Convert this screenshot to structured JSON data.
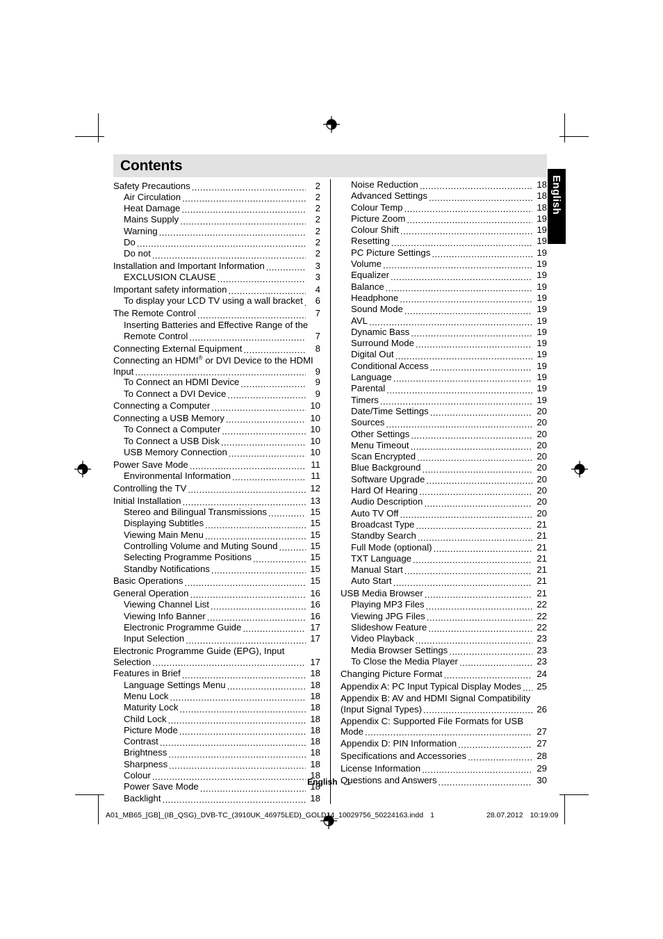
{
  "document": {
    "header_title": "Contents",
    "language_tab": "English",
    "footer": {
      "language": "English",
      "page_number": "- 1 -"
    },
    "print_info": {
      "filename": "A01_MB65_[GB]_(IB_QSG)_DVB-TC_(3910UK_46975LED)_GOLD14_10029756_50224163.indd",
      "sheet": "1",
      "date": "28.07.2012",
      "time": "10:19:09"
    }
  },
  "toc": {
    "left_column": [
      {
        "title": "Safety Precautions",
        "page": "2",
        "level": 1
      },
      {
        "title": "Air Circulation",
        "page": "2",
        "level": 2
      },
      {
        "title": "Heat Damage",
        "page": "2",
        "level": 2
      },
      {
        "title": "Mains Supply",
        "page": "2",
        "level": 2
      },
      {
        "title": "Warning ",
        "page": "2",
        "level": 2
      },
      {
        "title": "Do",
        "page": "2",
        "level": 2
      },
      {
        "title": "Do not",
        "page": "2",
        "level": 2
      },
      {
        "title": "Installation and Important Information",
        "page": "3",
        "level": 1
      },
      {
        "title": "EXCLUSION CLAUSE",
        "page": "3",
        "level": 2
      },
      {
        "title": "Important safety information ",
        "page": "4",
        "level": 1
      },
      {
        "title": "To display your LCD TV using a wall bracket",
        "page": "6",
        "level": 2
      },
      {
        "title": "The Remote Control",
        "page": "7",
        "level": 1
      },
      {
        "title": "Inserting Batteries and Effective Range of the",
        "title2": "Remote Control",
        "page": "7",
        "level": 2,
        "wrap": true
      },
      {
        "title": "Connecting External Equipment",
        "page": "8",
        "level": 1
      },
      {
        "title": "Connecting an HDMI",
        "sup": "®",
        "title_after_sup": " or DVI Device to the HDMI",
        "title2": "Input",
        "page": "9",
        "level": 1,
        "wrap": true,
        "tight": true
      },
      {
        "title": "To Connect an HDMI Device",
        "page": "9",
        "level": 2
      },
      {
        "title": "To Connect a DVI Device",
        "page": "9",
        "level": 2
      },
      {
        "title": "Connecting a Computer",
        "page": "10",
        "level": 1
      },
      {
        "title": "Connecting a USB Memory",
        "page": "10",
        "level": 1
      },
      {
        "title": "To Connect a Computer",
        "page": "10",
        "level": 2
      },
      {
        "title": "To Connect a USB Disk",
        "page": "10",
        "level": 2
      },
      {
        "title": "USB Memory Connection",
        "page": "10",
        "level": 2
      },
      {
        "title": "Power Save Mode",
        "page": "11",
        "level": 1
      },
      {
        "title": "Environmental Information ",
        "page": "11",
        "level": 2
      },
      {
        "title": "Controlling the TV",
        "page": "12",
        "level": 1
      },
      {
        "title": "Initial Installation ",
        "page": "13",
        "level": 1
      },
      {
        "title": "Stereo and Bilingual Transmissions",
        "page": "15",
        "level": 2
      },
      {
        "title": "Displaying Subtitles",
        "page": "15",
        "level": 2
      },
      {
        "title": "Viewing Main Menu",
        "page": "15",
        "level": 2
      },
      {
        "title": "Controlling Volume and Muting Sound",
        "page": "15",
        "level": 2
      },
      {
        "title": "Selecting Programme Positions",
        "page": "15",
        "level": 2
      },
      {
        "title": "Standby Notifications",
        "page": "15",
        "level": 2
      },
      {
        "title": "Basic Operations",
        "page": "15",
        "level": 1
      },
      {
        "title": "General Operation",
        "page": "16",
        "level": 1
      },
      {
        "title": "Viewing Channel List",
        "page": "16",
        "level": 2
      },
      {
        "title": "Viewing Info Banner",
        "page": "16",
        "level": 2
      },
      {
        "title": "Electronic Programme Guide",
        "page": "17",
        "level": 2
      },
      {
        "title": "Input Selection",
        "page": "17",
        "level": 2
      },
      {
        "title": "Electronic Programme Guide (EPG), Input",
        "title2": "Selection",
        "page": "17",
        "level": 1,
        "wrap": true,
        "tight": true
      },
      {
        "title": "Features in Brief ",
        "page": "18",
        "level": 1
      },
      {
        "title": "Language Settings Menu",
        "page": "18",
        "level": 2
      },
      {
        "title": "Menu Lock",
        "page": "18",
        "level": 2
      },
      {
        "title": "Maturity Lock",
        "page": "18",
        "level": 2
      },
      {
        "title": "Child Lock",
        "page": "18",
        "level": 2
      },
      {
        "title": "Picture Mode",
        "page": "18",
        "level": 2
      },
      {
        "title": "Contrast",
        "page": "18",
        "level": 2
      },
      {
        "title": "Brightness",
        "page": "18",
        "level": 2
      },
      {
        "title": "Sharpness",
        "page": "18",
        "level": 2
      },
      {
        "title": "Colour",
        "page": "18",
        "level": 2
      },
      {
        "title": "Power Save Mode ",
        "page": "18",
        "level": 2
      },
      {
        "title": "Backlight",
        "page": "18",
        "level": 2
      }
    ],
    "right_column": [
      {
        "title": "Noise Reduction",
        "page": "18",
        "level": 2
      },
      {
        "title": "Advanced Settings",
        "page": "18",
        "level": 2
      },
      {
        "title": "Colour Temp",
        "page": "18",
        "level": 2
      },
      {
        "title": "Picture Zoom",
        "page": "19",
        "level": 2
      },
      {
        "title": "Colour Shift",
        "page": "19",
        "level": 2
      },
      {
        "title": "Resetting",
        "page": "19",
        "level": 2
      },
      {
        "title": "PC Picture Settings",
        "page": "19",
        "level": 2
      },
      {
        "title": "Volume",
        "page": "19",
        "level": 2
      },
      {
        "title": "Equalizer",
        "page": "19",
        "level": 2
      },
      {
        "title": "Balance",
        "page": "19",
        "level": 2
      },
      {
        "title": "Headphone",
        "page": "19",
        "level": 2
      },
      {
        "title": "Sound Mode",
        "page": "19",
        "level": 2
      },
      {
        "title": "AVL",
        "page": "19",
        "level": 2
      },
      {
        "title": "Dynamic Bass",
        "page": "19",
        "level": 2
      },
      {
        "title": "Surround Mode",
        "page": "19",
        "level": 2
      },
      {
        "title": "Digital Out",
        "page": "19",
        "level": 2
      },
      {
        "title": "Conditional Access",
        "page": "19",
        "level": 2
      },
      {
        "title": "Language",
        "page": "19",
        "level": 2
      },
      {
        "title": "Parental",
        "page": "19",
        "level": 2
      },
      {
        "title": "Timers",
        "page": "19",
        "level": 2
      },
      {
        "title": "Date/Time Settings",
        "page": "20",
        "level": 2
      },
      {
        "title": "Sources",
        "page": "20",
        "level": 2
      },
      {
        "title": "Other Settings",
        "page": "20",
        "level": 2
      },
      {
        "title": "Menu Timeout",
        "page": "20",
        "level": 2
      },
      {
        "title": "Scan Encrypted ",
        "page": "20",
        "level": 2
      },
      {
        "title": "Blue Background ",
        "page": "20",
        "level": 2
      },
      {
        "title": "Software Upgrade",
        "page": "20",
        "level": 2
      },
      {
        "title": "Hard Of Hearing",
        "page": "20",
        "level": 2
      },
      {
        "title": "Audio Description",
        "page": "20",
        "level": 2
      },
      {
        "title": "Auto TV Off",
        "page": "20",
        "level": 2
      },
      {
        "title": "Broadcast Type",
        "page": "21",
        "level": 2
      },
      {
        "title": "Standby Search",
        "page": "21",
        "level": 2
      },
      {
        "title": "Full Mode (optional)",
        "page": "21",
        "level": 2
      },
      {
        "title": "TXT Language",
        "page": "21",
        "level": 2
      },
      {
        "title": "Manual Start",
        "page": "21",
        "level": 2
      },
      {
        "title": "Auto Start",
        "page": "21",
        "level": 2
      },
      {
        "title": "USB Media Browser",
        "page": "21",
        "level": 1
      },
      {
        "title": "Playing MP3 Files",
        "page": "22",
        "level": 2
      },
      {
        "title": "Viewing JPG Files",
        "page": "22",
        "level": 2
      },
      {
        "title": "Slideshow Feature",
        "page": "22",
        "level": 2
      },
      {
        "title": "Video Playback",
        "page": "23",
        "level": 2
      },
      {
        "title": "Media Browser Settings",
        "page": "23",
        "level": 2
      },
      {
        "title": "To Close the Media Player",
        "page": "23",
        "level": 2
      },
      {
        "title": "Changing Picture Format",
        "page": "24",
        "level": 1
      },
      {
        "title": "Appendix A: PC Input Typical Display Modes",
        "page": "25",
        "level": 1
      },
      {
        "title": "Appendix B: AV and HDMI Signal Compatibility",
        "title2": "(Input Signal Types)",
        "page": "26",
        "level": 1,
        "wrap": true,
        "tight": true
      },
      {
        "title": "Appendix C: Supported File Formats for USB",
        "title2": "Mode",
        "page": "27",
        "level": 1,
        "wrap": true,
        "tight": true
      },
      {
        "title": "Appendix D: PIN Information ",
        "page": "27",
        "level": 1
      },
      {
        "title": "Specifications and Accessories ",
        "page": "28",
        "level": 1
      },
      {
        "title": "License Information ",
        "page": "29",
        "level": 1
      },
      {
        "title": "Questions and Answers",
        "page": "30",
        "level": 1
      }
    ]
  }
}
